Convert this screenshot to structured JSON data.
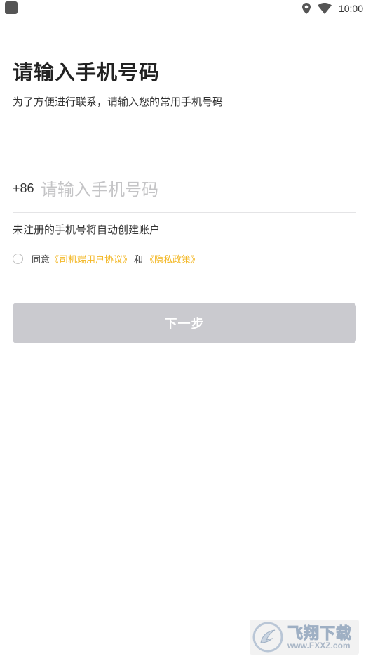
{
  "status_bar": {
    "time": "10:00",
    "icons": [
      "app-indicator-icon",
      "location-icon",
      "wifi-icon"
    ]
  },
  "header": {
    "title": "请输入手机号码",
    "subtitle": "为了方便进行联系，请输入您的常用手机号码"
  },
  "phone": {
    "country_code": "+86",
    "value": "",
    "placeholder": "请输入手机号码"
  },
  "hint": "未注册的手机号将自动创建账户",
  "agreement": {
    "checked": false,
    "prefix": "同意",
    "user_agreement_link": "《司机端用户协议》",
    "conjunction": "和",
    "privacy_link": "《隐私政策》",
    "link_color": "#f3b724"
  },
  "next_button": {
    "label": "下一步",
    "enabled": false,
    "color": "#cacacf"
  },
  "watermark": {
    "brand": "飞翔下载",
    "url": "www.FXXZ.com"
  }
}
